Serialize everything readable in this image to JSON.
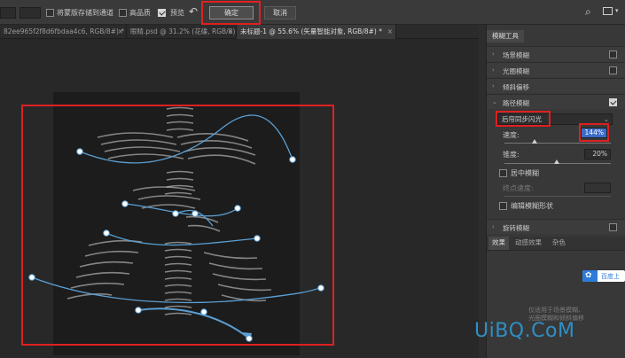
{
  "options_bar": {
    "save_mask_label": "将蒙版存储到通道",
    "high_quality_label": "高品质",
    "preview_label": "预览",
    "ok_label": "确定",
    "cancel_label": "取消"
  },
  "tabs": [
    {
      "label": "82ee965f2f8d6fbdaa4c6, RGB/8#) *",
      "close": "×"
    },
    {
      "label": "眼睛.psd @ 31.2% (花碟, RGB/8) *",
      "close": "×"
    },
    {
      "label": "未标题-1 @ 55.6% (矢量智能对象, RGB/8#) *",
      "close": "×"
    }
  ],
  "panel": {
    "title": "模糊工具",
    "rows": [
      {
        "label": "场景模糊",
        "checked": false
      },
      {
        "label": "光圈模糊",
        "checked": false
      },
      {
        "label": "倾斜偏移",
        "checked": false
      },
      {
        "label": "路径模糊",
        "checked": true
      }
    ],
    "path_blur": {
      "mode": "后帘同步闪光",
      "speed_label": "速度:",
      "speed_value": "144%",
      "taper_label": "锥度:",
      "taper_value": "20%",
      "centered_label": "居中模糊",
      "endpoint_speed_label": "终点速度:",
      "edit_shapes_label": "编辑模糊形状"
    },
    "spin_row": {
      "label": "旋转模糊",
      "checked": false
    },
    "bottom_tabs": [
      "效果",
      "动感效果",
      "杂色"
    ],
    "info_lines": [
      "仅适用于场景模糊、",
      "光圈模糊和倾斜偏移"
    ]
  },
  "overlay": {
    "baidu_label": "百度上",
    "watermark": "UiBQ.CoM"
  },
  "colors": {
    "highlight_red": "#e02020",
    "path_blue": "#5a9fd4",
    "accent_blue": "#3a6cc8"
  }
}
